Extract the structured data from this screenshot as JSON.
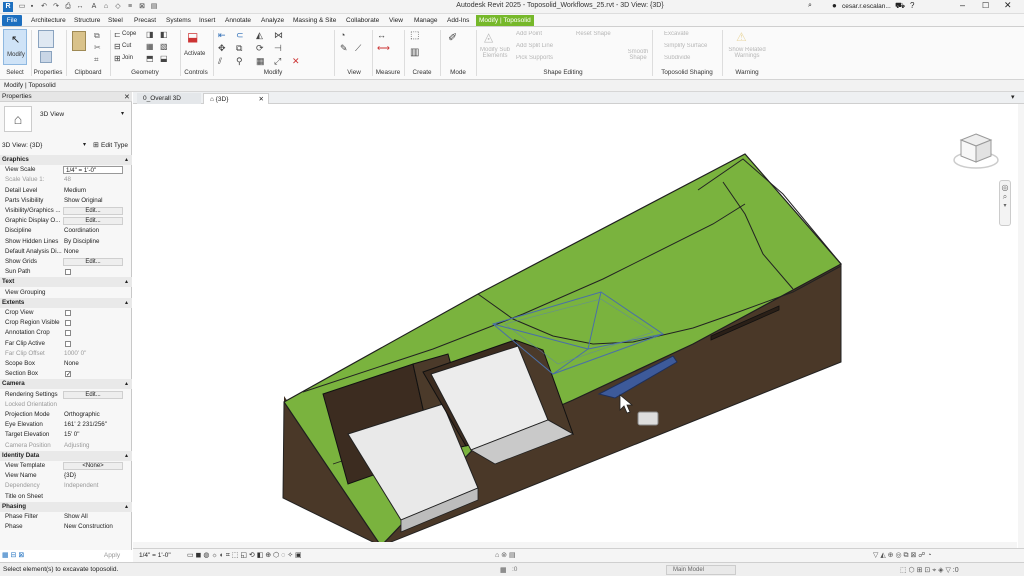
{
  "titlebar": {
    "title": "Autodesk Revit 2025 - Toposolid_Workflows_25.rvt - 3D View: {3D}",
    "user": "cesar.r.escalan..."
  },
  "tabs": [
    "File",
    "Architecture",
    "Structure",
    "Steel",
    "Precast",
    "Systems",
    "Insert",
    "Annotate",
    "Analyze",
    "Massing & Site",
    "Collaborate",
    "View",
    "Manage",
    "Add-Ins",
    "Modify | Toposolid"
  ],
  "ribbon": {
    "modify": "Modify",
    "select": "Select",
    "properties": "Properties",
    "clipboard": "Clipboard",
    "cope": "Cope",
    "cut": "Cut",
    "join": "Join",
    "geometry": "Geometry",
    "activate": "Activate",
    "controls": "Controls",
    "modify_panel": "Modify",
    "view": "View",
    "measure": "Measure",
    "create": "Create",
    "mode": "Mode",
    "add_point": "Add Point",
    "add_split_line": "Add Split Line",
    "pick_supports": "Pick Supports",
    "modify_sub_elements": "Modify Sub Elements",
    "reset_shape": "Reset Shape",
    "smooth_shape": "Smooth Shape",
    "shape_editing": "Shape Editing",
    "toposolid_shaping": "Toposolid Shaping",
    "excavate": "Excavate",
    "simplify": "Simplify Surface",
    "subdivide": "Subdivide",
    "warning": "Warning",
    "show_related": "Show Related Warnings"
  },
  "modbar": "Modify | Toposolid",
  "properties": {
    "title": "Properties",
    "type_name": "3D View",
    "selector": "3D View: {3D}",
    "edit_type": "Edit Type",
    "rows": [
      {
        "cat": "Graphics"
      },
      {
        "k": "View Scale",
        "v": "1/4\" = 1'-0\"",
        "input": true
      },
      {
        "k": "Scale Value    1:",
        "v": "48",
        "grey": true
      },
      {
        "k": "Detail Level",
        "v": "Medium"
      },
      {
        "k": "Parts Visibility",
        "v": "Show Original"
      },
      {
        "k": "Visibility/Graphics ...",
        "v": "Edit...",
        "btn": true
      },
      {
        "k": "Graphic Display O...",
        "v": "Edit...",
        "btn": true
      },
      {
        "k": "Discipline",
        "v": "Coordination"
      },
      {
        "k": "Show Hidden Lines",
        "v": "By Discipline"
      },
      {
        "k": "Default Analysis Di...",
        "v": "None"
      },
      {
        "k": "Show Grids",
        "v": "Edit...",
        "btn": true
      },
      {
        "k": "Sun Path",
        "chk": false
      },
      {
        "cat": "Text"
      },
      {
        "k": "View Grouping",
        "v": ""
      },
      {
        "cat": "Extents"
      },
      {
        "k": "Crop View",
        "chk": false
      },
      {
        "k": "Crop Region Visible",
        "chk": false
      },
      {
        "k": "Annotation Crop",
        "chk": false
      },
      {
        "k": "Far Clip Active",
        "chk": false
      },
      {
        "k": "Far Clip Offset",
        "v": "1000' 0\"",
        "grey": true
      },
      {
        "k": "Scope Box",
        "v": "None"
      },
      {
        "k": "Section Box",
        "chk": true
      },
      {
        "cat": "Camera"
      },
      {
        "k": "Rendering Settings",
        "v": "Edit...",
        "btn": true
      },
      {
        "k": "Locked Orientation",
        "v": "",
        "grey": true
      },
      {
        "k": "Projection Mode",
        "v": "Orthographic"
      },
      {
        "k": "Eye Elevation",
        "v": "161' 2 231/256\""
      },
      {
        "k": "Target Elevation",
        "v": "15' 0\""
      },
      {
        "k": "Camera Position",
        "v": "Adjusting",
        "grey": true
      },
      {
        "cat": "Identity Data"
      },
      {
        "k": "View Template",
        "v": "<None>",
        "btn": true
      },
      {
        "k": "View Name",
        "v": "{3D}"
      },
      {
        "k": "Dependency",
        "v": "Independent",
        "grey": true
      },
      {
        "k": "Title on Sheet",
        "v": ""
      },
      {
        "cat": "Phasing"
      },
      {
        "k": "Phase Filter",
        "v": "Show All"
      },
      {
        "k": "Phase",
        "v": "New Construction"
      }
    ],
    "apply": "Apply"
  },
  "viewtabs": [
    {
      "label": "0_Overall 3D"
    },
    {
      "label": "{3D}",
      "active": true
    }
  ],
  "viewbar": {
    "scale": "1/4\" = 1'-0\"",
    "model": "Main Model"
  },
  "status": "Select element(s) to excavate toposolid.",
  "colors": {
    "accent": "#1d6fbf",
    "context": "#76b82a",
    "grass": "#7ab33e",
    "soil": "#4a3828"
  }
}
